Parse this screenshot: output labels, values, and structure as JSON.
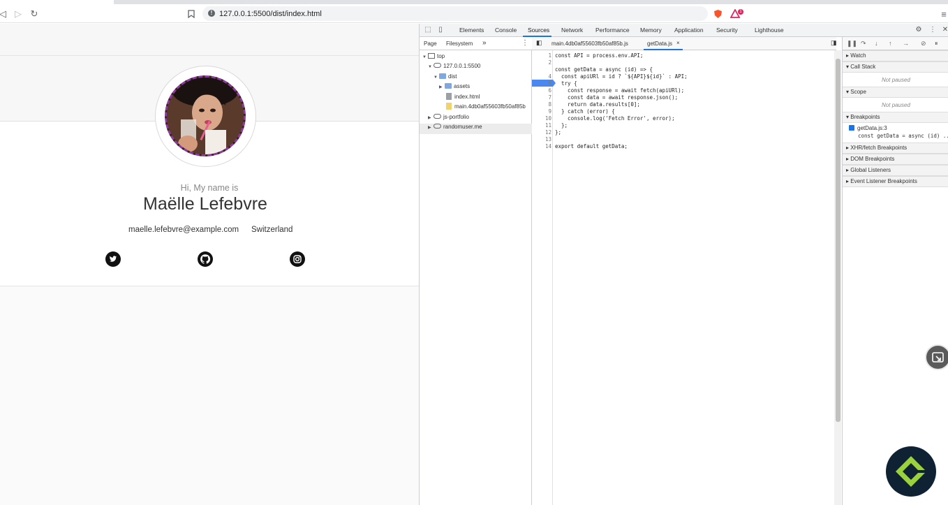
{
  "browser": {
    "url": "127.0.0.1:5500/dist/index.html",
    "icons": [
      "back-icon",
      "forward-icon",
      "reload-icon",
      "bookmark-icon",
      "info-icon",
      "brave-shield-icon",
      "brave-rewards-icon",
      "menu-icon"
    ],
    "notification_count": "1"
  },
  "page": {
    "intro": "Hi, My name is",
    "name": "Maëlle Lefebvre",
    "email": "maelle.lefebvre@example.com",
    "country": "Switzerland",
    "social": [
      "twitter-icon",
      "github-icon",
      "instagram-icon"
    ]
  },
  "devtools": {
    "tabs": [
      "Elements",
      "Console",
      "Sources",
      "Network",
      "Performance",
      "Memory",
      "Application",
      "Security",
      "Lighthouse"
    ],
    "active_tab": "Sources",
    "navigator": {
      "tabs": [
        "Page",
        "Filesystem"
      ],
      "more": "»",
      "tree": {
        "top": "top",
        "host": "127.0.0.1:5500",
        "dist": "dist",
        "assets": "assets",
        "index": "index.html",
        "main": "main.4db0af55603fb50af85b",
        "portfolio": "js-portfolio",
        "randomuser": "randomuser.me"
      }
    },
    "editor": {
      "tabs": [
        "main.4db0af55603fb50af85b.js",
        "getData.js"
      ],
      "close": "×",
      "line_numbers": [
        "1",
        "2",
        "3",
        "4",
        "5",
        "6",
        "7",
        "8",
        "9",
        "10",
        "11",
        "12",
        "13",
        "14"
      ],
      "lines": [
        "const API = process.env.API;",
        "",
        "const getData = async (id) => {",
        "  const apiURl = id ? `${API}${id}` : API;",
        "  try {",
        "    const response = await fetch(apiURl);",
        "    const data = await response.json();",
        "    return data.results[0];",
        "  } catch (error) {",
        "    console.log('Fetch Error', error);",
        "  };",
        "};",
        "",
        "export default getData;"
      ],
      "breakpoint_line": 3
    },
    "debugger": {
      "sections": [
        "Watch",
        "Call Stack",
        "Scope",
        "Breakpoints",
        "XHR/fetch Breakpoints",
        "DOM Breakpoints",
        "Global Listeners",
        "Event Listener Breakpoints"
      ],
      "not_paused": "Not paused",
      "breakpoint_file": "getData.js:3",
      "breakpoint_code": "const getData = async (id) ..."
    }
  }
}
